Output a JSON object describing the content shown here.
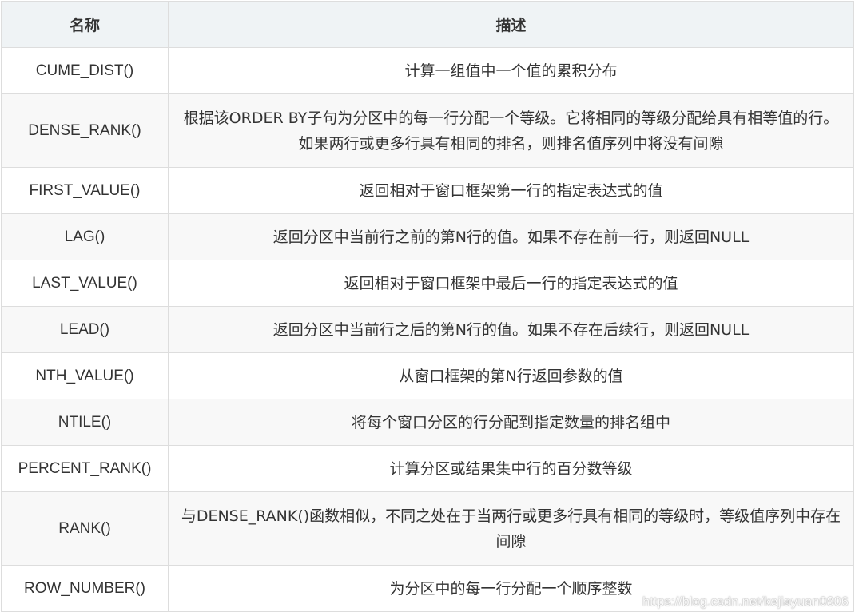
{
  "header": {
    "name_col": "名称",
    "desc_col": "描述"
  },
  "rows": [
    {
      "name": "CUME_DIST()",
      "desc": "计算一组值中一个值的累积分布"
    },
    {
      "name": "DENSE_RANK()",
      "desc": "根据该ORDER BY子句为分区中的每一行分配一个等级。它将相同的等级分配给具有相等值的行。如果两行或更多行具有相同的排名，则排名值序列中将没有间隙"
    },
    {
      "name": "FIRST_VALUE()",
      "desc": "返回相对于窗口框架第一行的指定表达式的值"
    },
    {
      "name": "LAG()",
      "desc": "返回分区中当前行之前的第N行的值。如果不存在前一行，则返回NULL"
    },
    {
      "name": "LAST_VALUE()",
      "desc": "返回相对于窗口框架中最后一行的指定表达式的值"
    },
    {
      "name": "LEAD()",
      "desc": "返回分区中当前行之后的第N行的值。如果不存在后续行，则返回NULL"
    },
    {
      "name": "NTH_VALUE()",
      "desc": "从窗口框架的第N行返回参数的值"
    },
    {
      "name": "NTILE()",
      "desc": "将每个窗口分区的行分配到指定数量的排名组中"
    },
    {
      "name": "PERCENT_RANK()",
      "desc": "计算分区或结果集中行的百分数等级"
    },
    {
      "name": "RANK()",
      "desc": "与DENSE_RANK()函数相似，不同之处在于当两行或更多行具有相同的等级时，等级值序列中存在间隙"
    },
    {
      "name": "ROW_NUMBER()",
      "desc": "为分区中的每一行分配一个顺序整数"
    }
  ],
  "watermark": "https://blog.csdn.net/kejiayuan0806"
}
